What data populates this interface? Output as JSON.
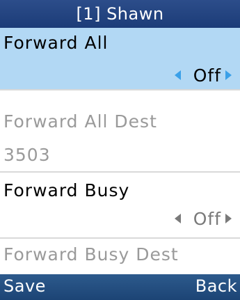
{
  "header": {
    "title": "[1] Shawn"
  },
  "menu": {
    "forward_all": {
      "label": "Forward All",
      "value": "Off"
    },
    "forward_all_dest": {
      "label": "Forward All Dest",
      "value": "3503"
    },
    "forward_busy": {
      "label": "Forward Busy",
      "value": "Off"
    },
    "forward_busy_dest": {
      "label": "Forward Busy Dest"
    }
  },
  "softkeys": {
    "left": "Save",
    "right": "Back"
  },
  "colors": {
    "titlebar": "#1c3c78",
    "selected_row": "#b2d8f4",
    "arrow_active": "#3aa0e8",
    "softkey_bar": "#1c4475"
  }
}
